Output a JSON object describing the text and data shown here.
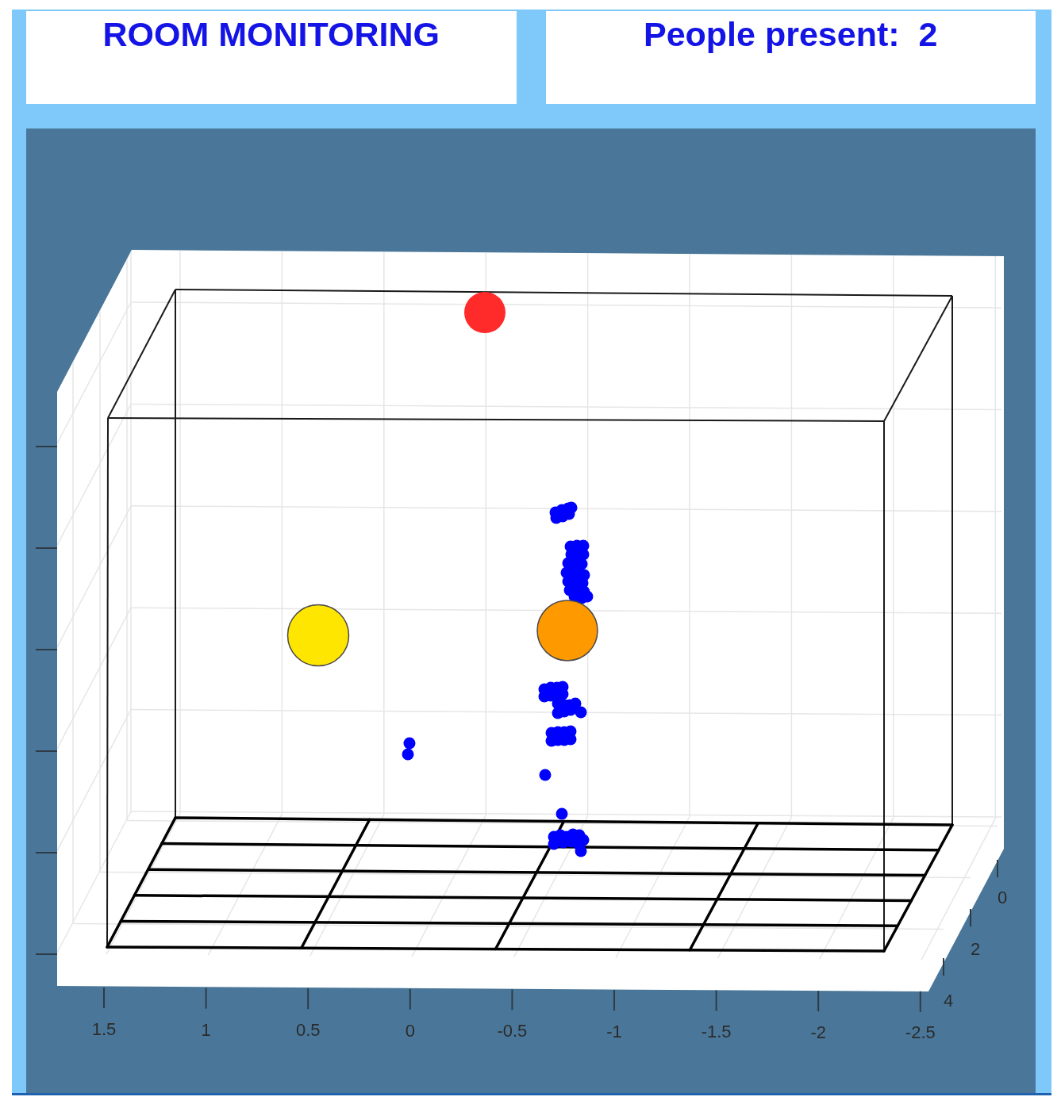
{
  "header": {
    "title": "ROOM MONITORING",
    "people_present": {
      "label": "People present:",
      "count": "2"
    }
  },
  "plot": {
    "x_ticks": [
      "1.5",
      "1",
      "0.5",
      "0",
      "-0.5",
      "-1",
      "-1.5",
      "-2",
      "-2.5"
    ],
    "y_ticks": [
      "0",
      "2",
      "4"
    ],
    "markers": [
      {
        "color": "#ff2b2b"
      },
      {
        "color": "#ffe600"
      },
      {
        "color": "#ff9900"
      }
    ]
  }
}
